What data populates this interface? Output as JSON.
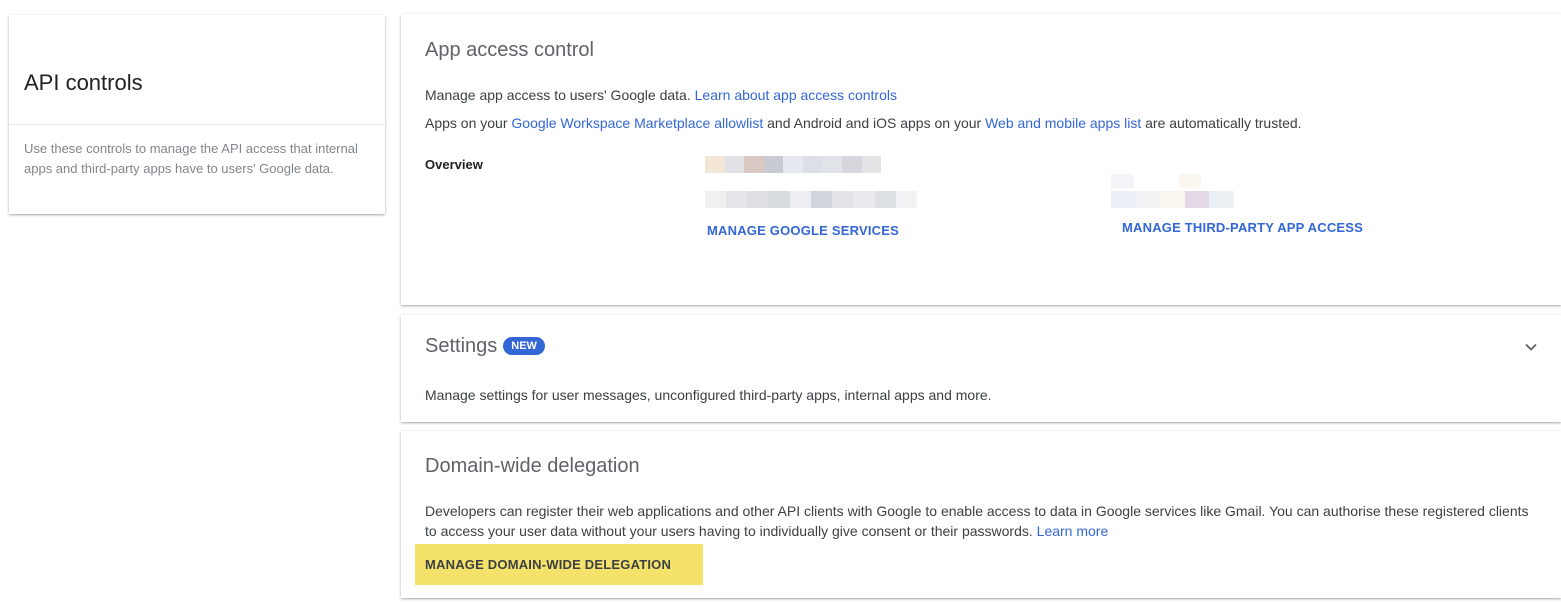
{
  "left_panel": {
    "title": "API controls",
    "description": "Use these controls to manage the API access that internal apps and third-party apps have to users' Google data."
  },
  "app_access": {
    "title": "App access control",
    "line1_text": "Manage app access to users' Google data. ",
    "line1_link": "Learn about app access controls",
    "line2_pre": "Apps on your ",
    "line2_link1": "Google Workspace Marketplace allowlist",
    "line2_mid": " and Android and iOS apps on your ",
    "line2_link2": "Web and mobile apps list",
    "line2_post": " are automatically trusted.",
    "overview_label": "Overview",
    "manage_google_services": "MANAGE GOOGLE SERVICES",
    "manage_third_party": "MANAGE THIRD-PARTY APP ACCESS"
  },
  "settings": {
    "title": "Settings",
    "badge": "NEW",
    "description": "Manage settings for user messages, unconfigured third-party apps, internal apps and more.",
    "chevron_icon": "chevron-down-icon"
  },
  "delegation": {
    "title": "Domain-wide delegation",
    "line1": "Developers can register their web applications and other API clients with Google to enable access to data in Google services like Gmail. You can authorise these registered clients",
    "line2_text": "to access your user data without your users having to individually give consent or their passwords. ",
    "line2_link": "Learn more",
    "button": "MANAGE DOMAIN-WIDE DELEGATION",
    "highlight_color": "#f5e26b"
  },
  "colors": {
    "link": "#3367d6",
    "badge_bg": "#3367d6",
    "title_gray": "#5f6368"
  }
}
